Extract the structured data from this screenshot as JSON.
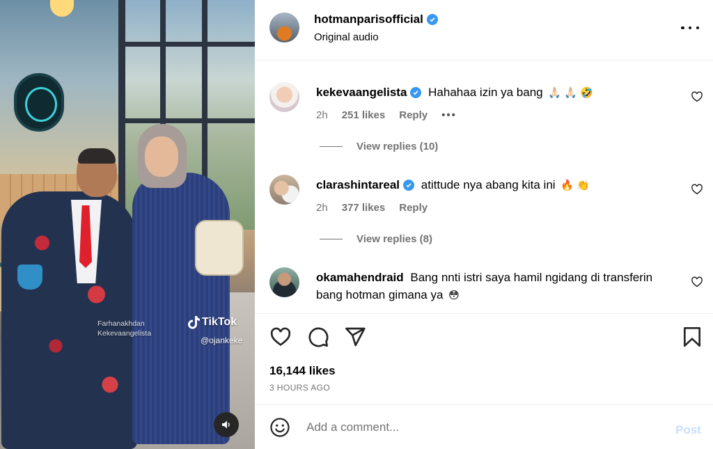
{
  "media": {
    "watermark_line1": "Farhanakhdan",
    "watermark_line2": "Kekevaangelista",
    "tiktok_brand": "TikTok",
    "tiktok_handle": "@ojankeke",
    "mute_icon": "speaker-icon"
  },
  "post": {
    "username": "hotmanparisofficial",
    "verified": true,
    "subtitle": "Original audio",
    "likes": "16,144 likes",
    "time_ago": "3 HOURS AGO"
  },
  "comments": [
    {
      "username": "kekevaangelista",
      "verified": true,
      "text": "Hahahaa izin ya bang",
      "emoji": "🙏🏻 🙏🏻 🤣",
      "time": "2h",
      "likes": "251 likes",
      "reply": "Reply",
      "more": "•••",
      "view_replies": "View replies (10)"
    },
    {
      "username": "clarashintareal",
      "verified": true,
      "text": "atittude nya abang kita ini",
      "emoji": "🔥 👏",
      "time": "2h",
      "likes": "377 likes",
      "reply": "Reply",
      "view_replies": "View replies (8)"
    },
    {
      "username": "okamahendraid",
      "verified": false,
      "text": "Bang nnti istri saya hamil ngidang di transferin bang hotman gimana ya",
      "emoji": "😳"
    }
  ],
  "composer": {
    "placeholder": "Add a comment...",
    "post_label": "Post"
  },
  "colors": {
    "verified": "#3897f0",
    "post_disabled": "#c7e0fd",
    "secondary_text": "#737373"
  }
}
